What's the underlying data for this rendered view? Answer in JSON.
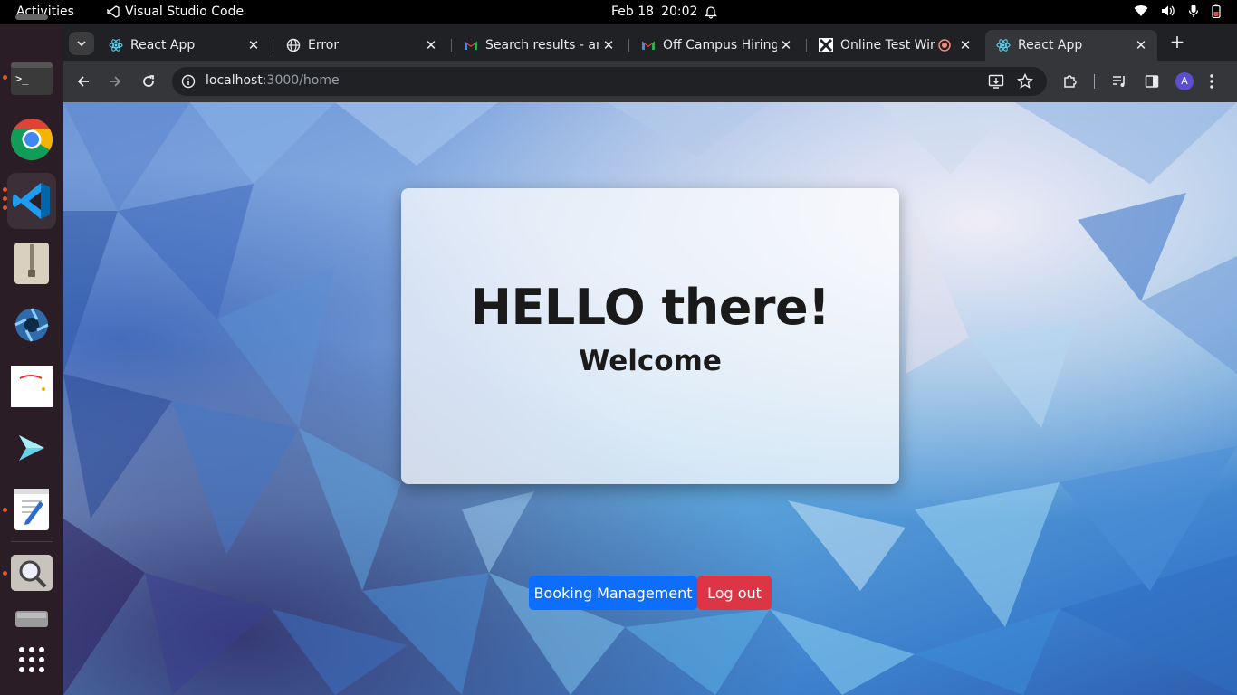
{
  "topbar": {
    "activities": "Activities",
    "app_name": "Visual Studio Code",
    "date": "Feb 18",
    "time": "20:02"
  },
  "dock": {
    "items": [
      {
        "name": "terminal-icon"
      },
      {
        "name": "chrome-icon"
      },
      {
        "name": "vscode-icon"
      },
      {
        "name": "archive-icon"
      },
      {
        "name": "app-aperture-icon"
      },
      {
        "name": "image-app-icon"
      },
      {
        "name": "app-chevron-icon"
      },
      {
        "name": "text-editor-icon"
      },
      {
        "name": "search-app-icon"
      },
      {
        "name": "drive-icon"
      },
      {
        "name": "show-apps-icon"
      }
    ]
  },
  "browser": {
    "tabs": [
      {
        "title": "React App",
        "icon": "react-icon"
      },
      {
        "title": "Error",
        "icon": "globe-icon"
      },
      {
        "title": "Search results - am",
        "icon": "gmail-icon"
      },
      {
        "title": "Off Campus Hiring",
        "icon": "gmail-icon"
      },
      {
        "title": "Online Test Wir",
        "icon": "test-site-icon"
      },
      {
        "title": "React App",
        "icon": "react-icon"
      }
    ],
    "address": {
      "host": "localhost",
      "path": ":3000/home"
    },
    "profile_initial": "A"
  },
  "page": {
    "heading": "HELLO there!",
    "subheading": "Welcome",
    "booking_button": "Booking Management",
    "logout_button": "Log out"
  },
  "colors": {
    "primary": "#0d6efd",
    "danger": "#dc3545",
    "dock_bg": "#2b1d26",
    "chrome_dark": "#202124"
  }
}
